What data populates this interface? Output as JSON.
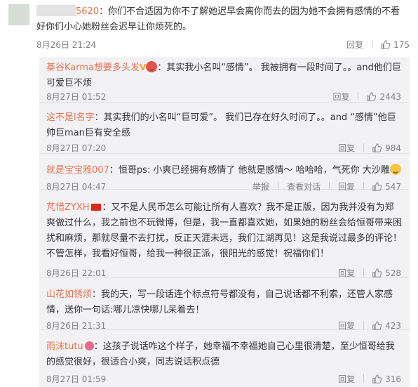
{
  "main_comment": {
    "username_visible": "5620",
    "text": "：你们不合适因为你不了解她迟早会离你而去的因为她不会拥有感情的不看好你们小心她粉丝会迟早让你烦死的。",
    "time": "8月26日 21:24",
    "reply_label": "回复",
    "like_count": "175"
  },
  "replies": [
    {
      "username": "棊谷Karma想要多头发",
      "text": "：其实我小名叫“感情”。 我被拥有一段时间了。。and他们巨可爱巨不烦",
      "time": "8月27日 01:52",
      "reply_label": "回复",
      "like_count": "2443"
    },
    {
      "username": "这不是l名字",
      "text": "：其实我们的小名叫“巨可爱”。 我们已存在好久时间了。。and “感情”他巨帅巨man巨有安全感",
      "time": "8月27日 07:20",
      "reply_label": "回复",
      "like_count": "984"
    },
    {
      "username": "就是宝宝雅007",
      "text": "：恒哥ps: 小爽已经拥有感情了 他就是感情～ 哈哈哈，气死你 大沙雕",
      "time": "8月27日 04:47",
      "report_label": "举报",
      "view_dialog_label": "查看对话",
      "reply_label": "回复",
      "like_count": "547"
    },
    {
      "username": "芃惜ZYXH",
      "text": "：又不是人民币怎么可能让所有人喜欢？我不是正版，因为我并没有为郑爽做过什么，我之前也不玩微博，但是，我一直都喜欢她，如果她的粉丝会给恒哥带来困扰和麻烦，那就尽量不去打扰，反正天涯未远，我们江湖再见！这是我说过最多的评论！不管怎样，我看好恒哥，给我一种很正派，很阳光的感觉！祝福你们！",
      "time": "8月26日 22:01",
      "reply_label": "回复",
      "like_count": "528"
    },
    {
      "username": "山花如锈烦",
      "text": "：我的天，写一段话连个标点符号都没有，自己说话都不利索，还管人家感情，送你一句话:哪儿凉快哪儿呆着去！",
      "time": "8月26日 21:31",
      "reply_label": "回复",
      "like_count": "423"
    },
    {
      "username": "雨沫tutu",
      "text": "：这孩子说话咋这个样子，她幸福不幸福她自己心里很清楚，至少恒哥给我的感觉很好，很适合小爽，同志说话积点德",
      "time": "8月27日 01:59",
      "reply_label": "回复",
      "like_count": "316"
    }
  ],
  "icons": {
    "like": "thumbs-up-icon",
    "flag": "china-flag-icon",
    "emoji": "grin-emoji-icon"
  },
  "colors": {
    "username": "#eb7350",
    "reply_bg": "#f2f2f5",
    "meta": "#808080"
  }
}
